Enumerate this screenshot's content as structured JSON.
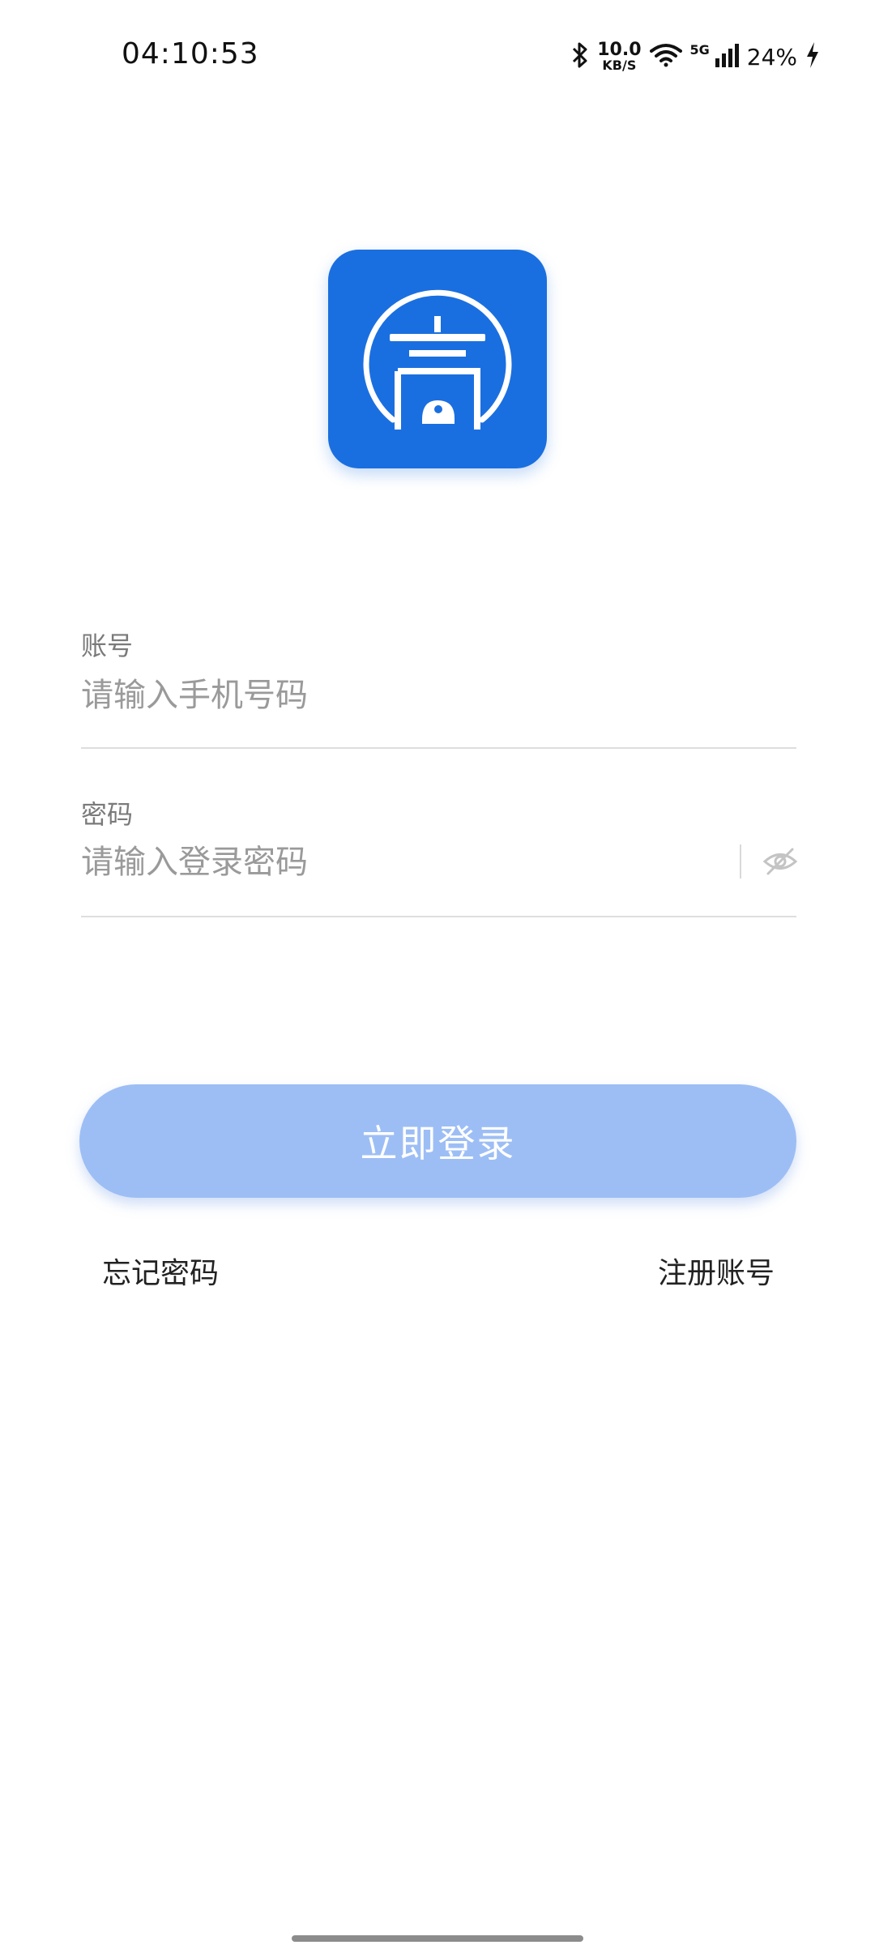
{
  "status_bar": {
    "time": "04:10:53",
    "net_speed_value": "10.0",
    "net_speed_unit": "KB/S",
    "network_type": "5G",
    "battery": "24%",
    "icons": [
      "bluetooth-icon",
      "wifi-icon",
      "signal-icon",
      "charging-icon"
    ]
  },
  "logo": {
    "icon": "app-logo-icon",
    "color": "#1a6fe0"
  },
  "form": {
    "account_label": "账号",
    "account_placeholder": "请输入手机号码",
    "password_label": "密码",
    "password_placeholder": "请输入登录密码",
    "password_toggle_icon": "eye-off-icon"
  },
  "login_button": {
    "label": "立即登录",
    "color": "#9dbef5"
  },
  "links": {
    "forgot_password": "忘记密码",
    "register": "注册账号"
  }
}
